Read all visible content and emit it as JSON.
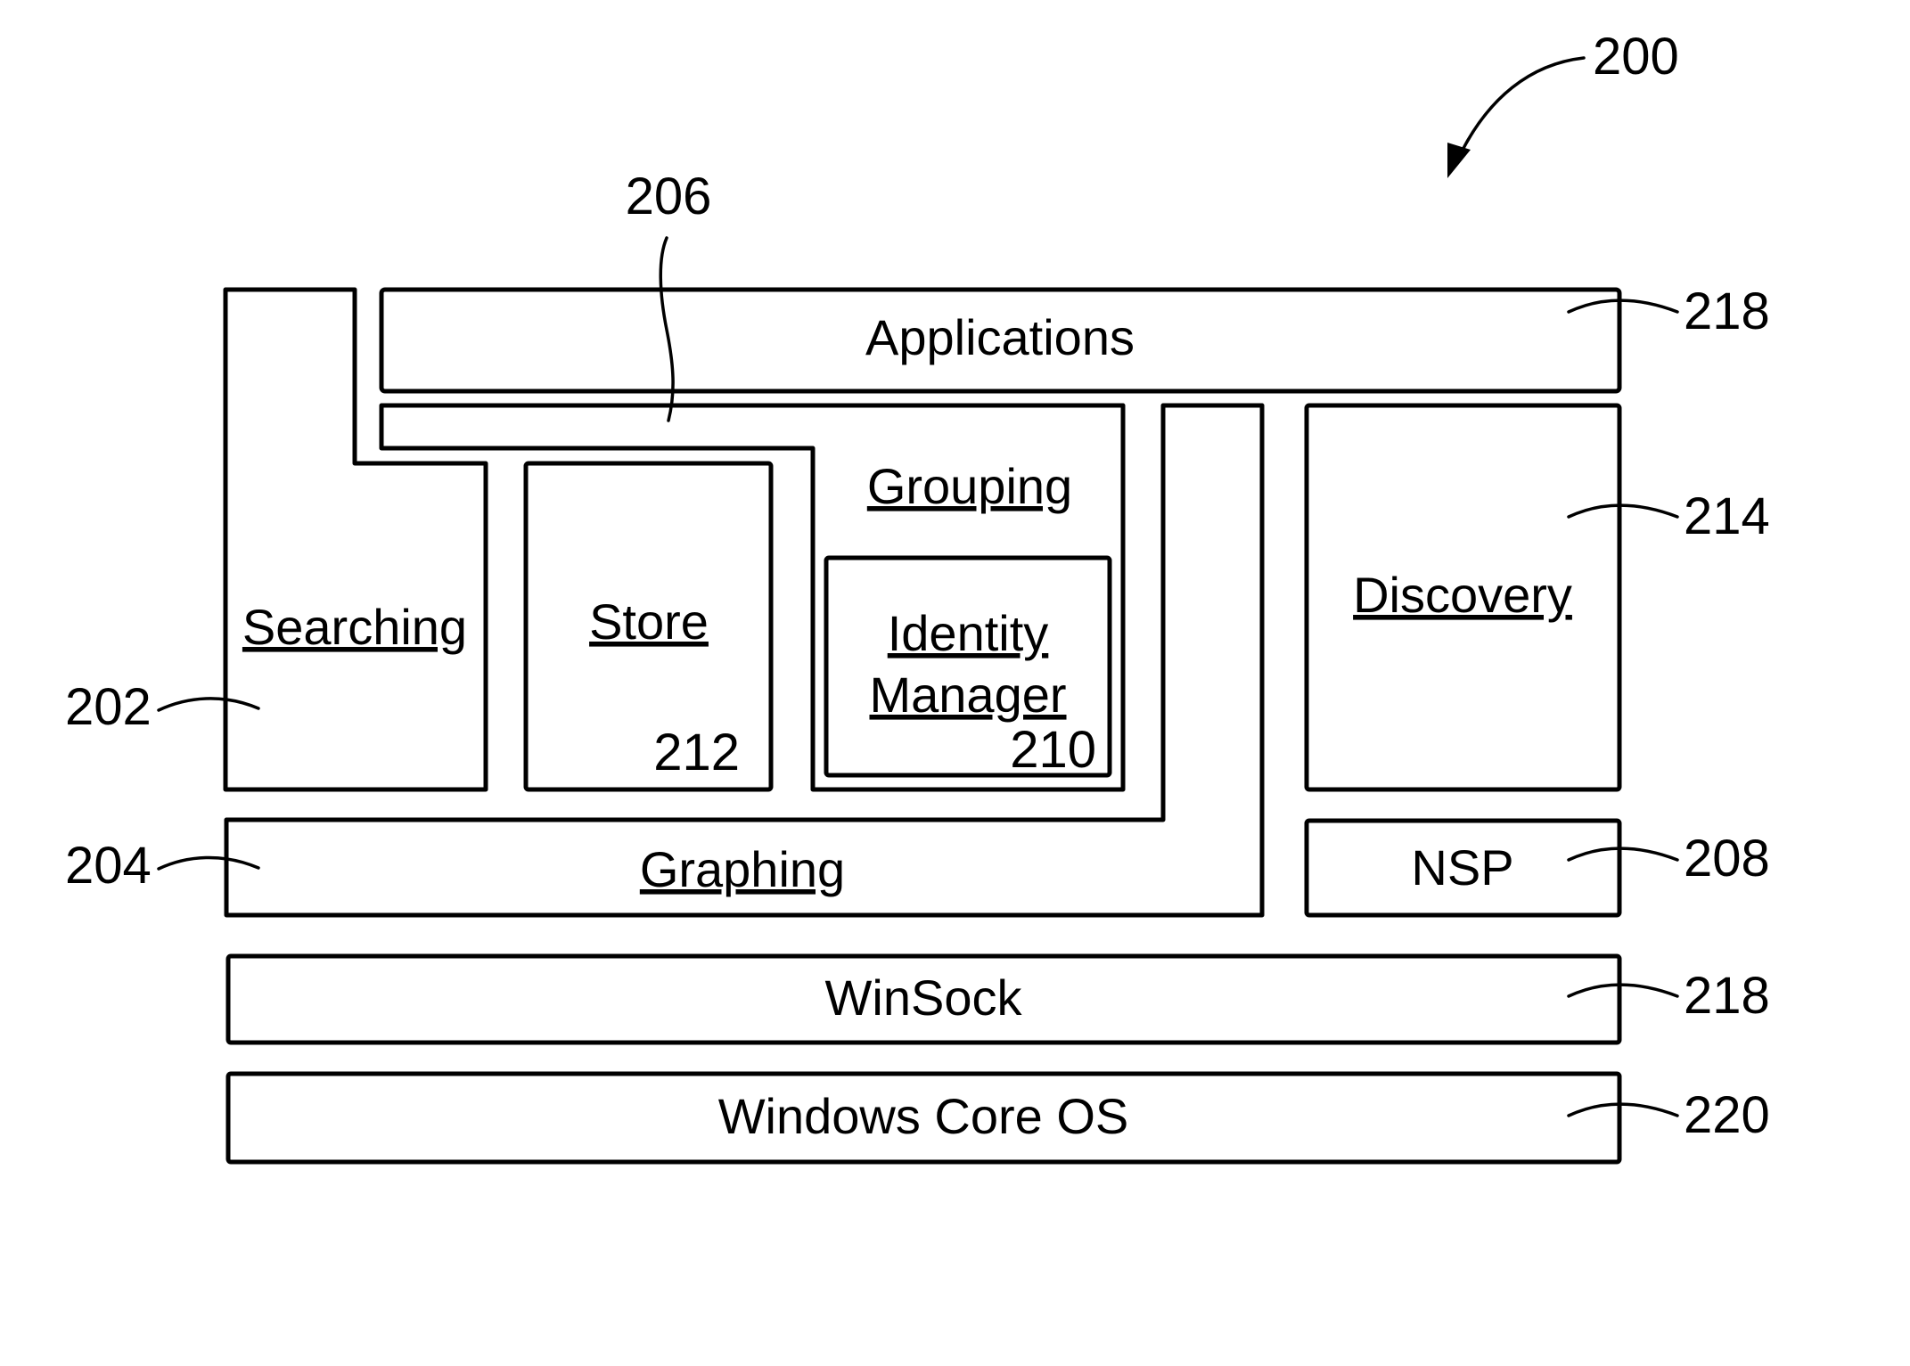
{
  "figure": {
    "reference": "200",
    "colors": {
      "line": "#000000",
      "background": "#ffffff"
    }
  },
  "components": {
    "applications": {
      "label": "Applications",
      "ref": "218",
      "underlined": false
    },
    "searching": {
      "label": "Searching",
      "ref": "202",
      "underlined": true
    },
    "graphing": {
      "label": "Graphing",
      "ref": "204",
      "underlined": true
    },
    "grouping_bar": {
      "ref": "206"
    },
    "store": {
      "label": "Store",
      "ref": "212",
      "underlined": true
    },
    "grouping": {
      "label": "Grouping",
      "underlined": true
    },
    "identity_manager": {
      "label_line1": "Identity",
      "label_line2": "Manager",
      "ref": "210",
      "underlined": true
    },
    "discovery": {
      "label": "Discovery",
      "ref": "214",
      "underlined": true
    },
    "nsp": {
      "label": "NSP",
      "ref": "208",
      "underlined": false
    },
    "winsock": {
      "label": "WinSock",
      "ref": "218",
      "underlined": false
    },
    "windows_core_os": {
      "label": "Windows Core OS",
      "ref": "220",
      "underlined": false
    }
  }
}
